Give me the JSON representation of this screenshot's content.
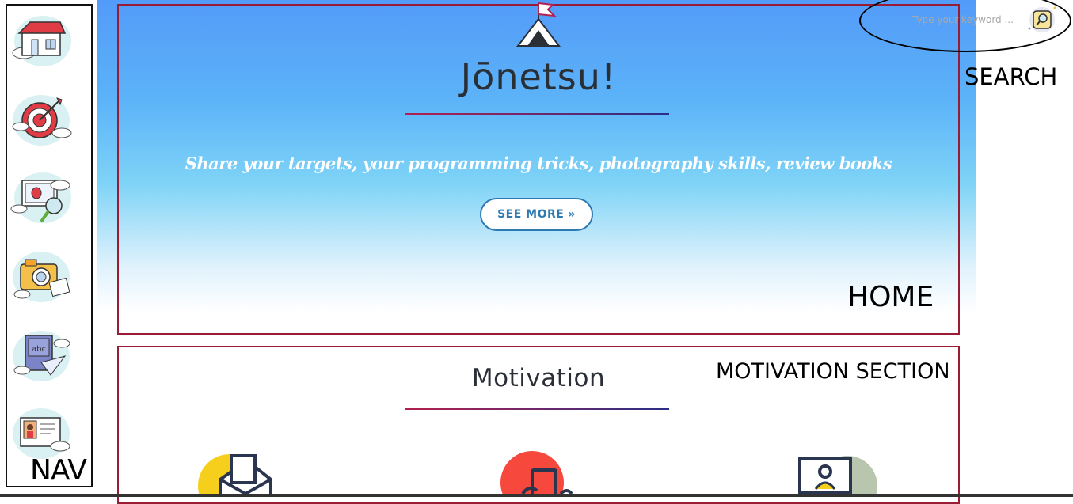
{
  "annotations": {
    "nav": "NAV",
    "search": "SEARCH",
    "home": "HOME",
    "motivation_section": "MOTIVATION SECTION"
  },
  "nav": {
    "items": [
      {
        "icon": "house-icon"
      },
      {
        "icon": "target-icon"
      },
      {
        "icon": "code-bug-icon"
      },
      {
        "icon": "camera-icon"
      },
      {
        "icon": "book-icon"
      },
      {
        "icon": "profile-card-icon"
      }
    ]
  },
  "search": {
    "placeholder": "Type your keyword ...",
    "button_icon": "search-icon"
  },
  "hero": {
    "title": "Jōnetsu!",
    "subtitle": "Share your targets, your programming tricks, photography skills, review books",
    "button_label": "SEE MORE",
    "button_icon": "double-chevron-right-icon",
    "logo_icon": "mountain-flag-icon"
  },
  "motivation": {
    "title": "Motivation",
    "icons": [
      "mail-icon",
      "phone-icon",
      "presentation-icon"
    ]
  },
  "colors": {
    "frame": "#9a1b34",
    "accent_blue": "#2d7ab3",
    "hero_top": "#539bf9"
  }
}
